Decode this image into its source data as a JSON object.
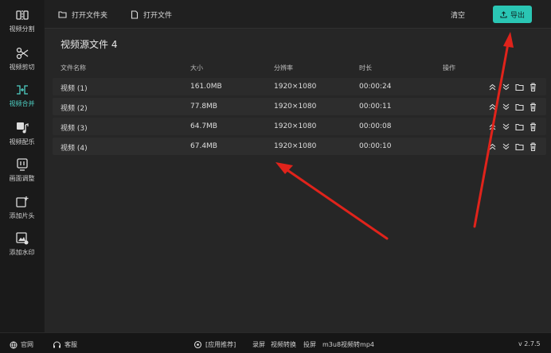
{
  "sidebar": {
    "items": [
      {
        "label": "视频分割",
        "icon": "split-icon"
      },
      {
        "label": "视频剪切",
        "icon": "scissors-icon"
      },
      {
        "label": "视频合并",
        "icon": "merge-icon",
        "active": true
      },
      {
        "label": "视频配乐",
        "icon": "music-icon"
      },
      {
        "label": "画面调整",
        "icon": "adjust-icon"
      },
      {
        "label": "添加片头",
        "icon": "add-intro-icon"
      },
      {
        "label": "添加水印",
        "icon": "watermark-icon"
      }
    ]
  },
  "toolbar": {
    "open_folder": "打开文件夹",
    "open_file": "打开文件",
    "clear": "清空",
    "export": "导出"
  },
  "content": {
    "title": "视频源文件 4",
    "columns": [
      "文件名称",
      "大小",
      "分辨率",
      "时长",
      "操作"
    ],
    "rows": [
      {
        "name": "视频 (1)",
        "size": "161.0MB",
        "resolution": "1920×1080",
        "duration": "00:00:24"
      },
      {
        "name": "视频 (2)",
        "size": "77.8MB",
        "resolution": "1920×1080",
        "duration": "00:00:11"
      },
      {
        "name": "视频 (3)",
        "size": "64.7MB",
        "resolution": "1920×1080",
        "duration": "00:00:08"
      },
      {
        "name": "视频 (4)",
        "size": "67.4MB",
        "resolution": "1920×1080",
        "duration": "00:00:10"
      }
    ]
  },
  "statusbar": {
    "website": "官网",
    "support": "客服",
    "recommend": "[应用推荐]",
    "screen_record": "录屏",
    "video_convert": "视频转换",
    "screenshot": "投屏",
    "m3u8": "m3u8视频转mp4",
    "version": "v 2.7.5"
  },
  "colors": {
    "accent": "#2ac6b4",
    "annotation": "#e0231b"
  }
}
